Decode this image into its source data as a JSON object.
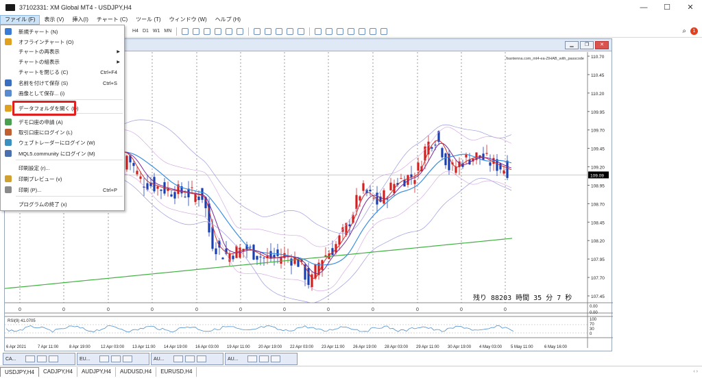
{
  "window": {
    "title": "37102331: XM Global MT4 - USDJPY,H4",
    "controls": [
      "—",
      "☐",
      "✕"
    ]
  },
  "menu": [
    "ファイル (F)",
    "表示 (V)",
    "挿入(I)",
    "チャート (C)",
    "ツール (T)",
    "ウィンドウ (W)",
    "ヘルプ (H)"
  ],
  "toolbar": {
    "timeframes": [
      "H4",
      "D1",
      "W1",
      "MN"
    ]
  },
  "file_menu": {
    "items": [
      {
        "label": "新規チャート (N)",
        "shortcut": "",
        "icon": "new-chart-icon",
        "color": "#3a7bd5"
      },
      {
        "label": "オフラインチャート (O)",
        "shortcut": "",
        "icon": "folder-open-icon",
        "color": "#e0a020"
      },
      {
        "label": "チャートの再表示",
        "shortcut": "",
        "submenu": true
      },
      {
        "label": "チャートの組表示",
        "shortcut": "",
        "submenu": true
      },
      {
        "label": "チャートを閉じる (C)",
        "shortcut": "Ctrl+F4"
      },
      {
        "label": "名前を付けて保存 (S)",
        "shortcut": "Ctrl+S",
        "icon": "save-icon",
        "color": "#3a6fc0"
      },
      {
        "label": "画像として保存... (i)",
        "shortcut": "",
        "icon": "image-icon",
        "color": "#5a8ad0"
      },
      {
        "label": "データフォルダを開く (D)",
        "shortcut": "",
        "icon": "data-folder-icon",
        "color": "#e0a020"
      },
      {
        "label": "デモ口座の申請 (A)",
        "shortcut": "",
        "icon": "demo-account-icon",
        "color": "#4aa050"
      },
      {
        "label": "取引口座にログイン (L)",
        "shortcut": "",
        "icon": "login-icon",
        "color": "#c06030"
      },
      {
        "label": "ウェブトレーダーにログイン (W)",
        "shortcut": "",
        "icon": "webtrader-icon",
        "color": "#3a90c0"
      },
      {
        "label": "MQL5.community にログイン (M)",
        "shortcut": "",
        "icon": "mql5-icon",
        "color": "#4a70b0"
      },
      {
        "label": "印刷設定 (r)...",
        "shortcut": ""
      },
      {
        "label": "印刷プレビュー (v)",
        "shortcut": "",
        "icon": "print-preview-icon",
        "color": "#d0a030"
      },
      {
        "label": "印刷 (P)...",
        "shortcut": "Ctrl+P",
        "icon": "print-icon",
        "color": "#8a8a8a"
      },
      {
        "label": "プログラムの終了 (x)",
        "shortcut": ""
      }
    ]
  },
  "chart": {
    "watermark": "fxantenna.com_mt4-ea-ZIHAB_with_passcode",
    "price_labels": [
      "110.70",
      "110.45",
      "110.20",
      "109.95",
      "109.70",
      "109.45",
      "109.20",
      "108.95",
      "108.70",
      "108.45",
      "108.20",
      "107.95",
      "107.70",
      "107.45"
    ],
    "current_price": "109.09",
    "timer": "残り 88203 時間 35 分 7 秒",
    "date_labels": [
      "6 Apr 2021",
      "7 Apr 11:00",
      "8 Apr 19:00",
      "12 Apr 03:00",
      "13 Apr 11:00",
      "14 Apr 19:00",
      "16 Apr 03:00",
      "19 Apr 11:00",
      "20 Apr 19:00",
      "22 Apr 03:00",
      "23 Apr 11:00",
      "26 Apr 19:00",
      "28 Apr 03:00",
      "29 Apr 11:00",
      "30 Apr 19:00",
      "4 May 03:00",
      "5 May 11:00",
      "6 May 16:00"
    ],
    "subwindow_zero": "0",
    "sub_scale": [
      "0.00",
      "0.00"
    ],
    "rsi_label": "RSI(9) 41.0705",
    "rsi_scale": [
      "100",
      "70",
      "30",
      "0"
    ]
  },
  "mini_windows": [
    "CA...",
    "EU...",
    "AU...",
    "AU..."
  ],
  "tabs": [
    "USDJPY,H4",
    "CADJPY,H4",
    "AUDJPY,H4",
    "AUDUSD,H4",
    "EURUSD,H4"
  ],
  "colors": {
    "highlight": "#e02020",
    "bull": "#d02020",
    "bear": "#1a3fb0",
    "ma_fast": "#d03030",
    "ma_mid": "#7a2a9a",
    "ma_blue": "#3a8ee0",
    "ma_orange": "#f08030",
    "ma_green": "#40b040"
  }
}
